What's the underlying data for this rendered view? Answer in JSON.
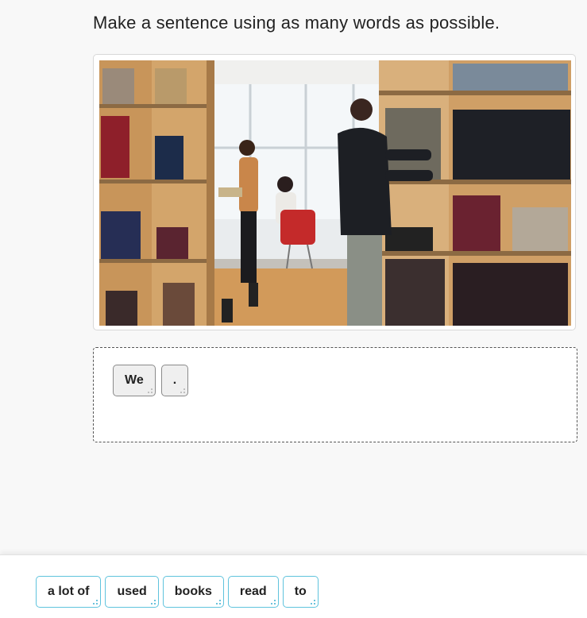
{
  "prompt": "Make a sentence using as many words as possible.",
  "image": {
    "icon": "library-photo"
  },
  "answer": {
    "tiles": [
      "We",
      "."
    ]
  },
  "word_bank": {
    "tiles": [
      "a lot of",
      "used",
      "books",
      "read",
      "to"
    ]
  },
  "colors": {
    "accent": "#5fc3dd",
    "placed_tile_bg": "#efefef"
  }
}
